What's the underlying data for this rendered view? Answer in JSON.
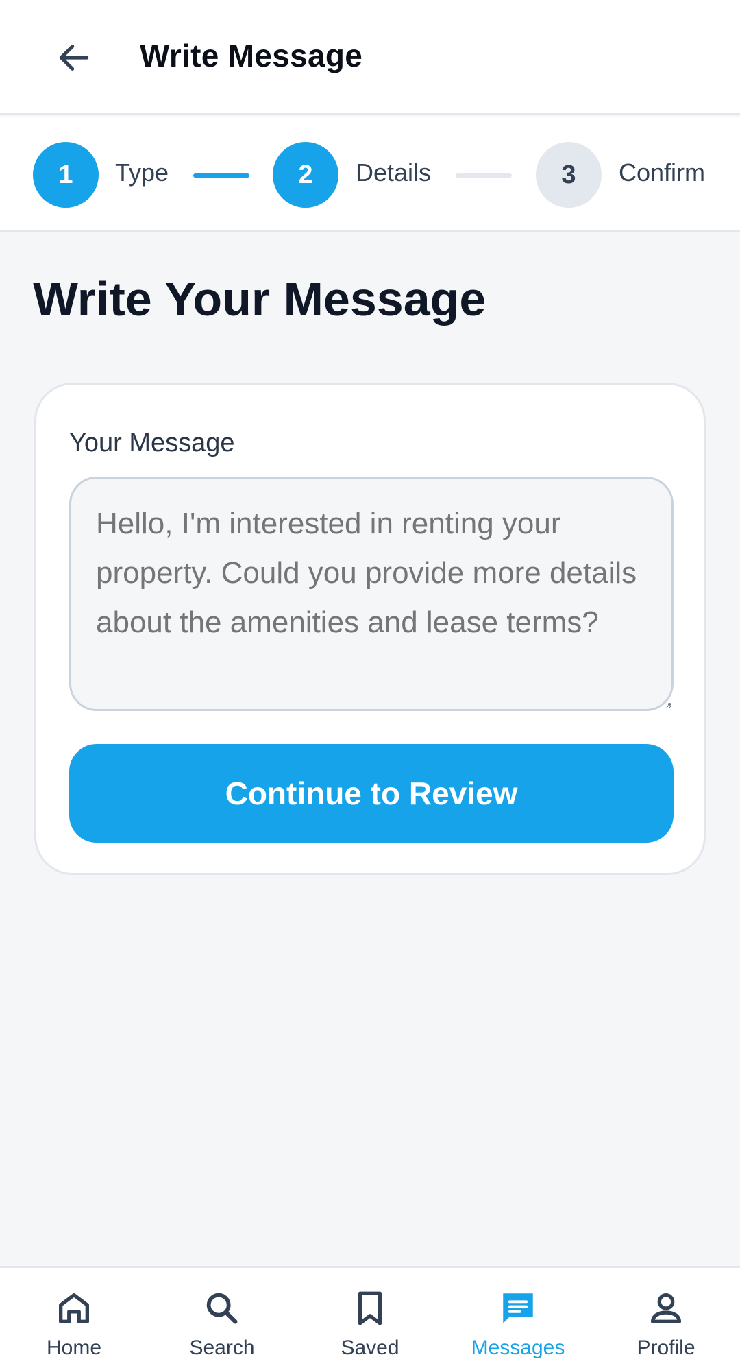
{
  "appbar": {
    "title": "Write Message",
    "back_icon": "arrow-left-icon"
  },
  "stepper": {
    "steps": [
      {
        "number": "1",
        "label": "Type",
        "state": "complete"
      },
      {
        "number": "2",
        "label": "Details",
        "state": "current"
      },
      {
        "number": "3",
        "label": "Confirm",
        "state": "upcoming"
      }
    ]
  },
  "page": {
    "heading": "Write Your Message"
  },
  "form": {
    "message_label": "Your Message",
    "message_placeholder": "Hello, I'm interested in renting your property. Could you provide more details about the amenities and lease terms?",
    "message_value": "",
    "submit_label": "Continue to Review"
  },
  "bottom_nav": {
    "items": [
      {
        "label": "Home",
        "icon": "home-icon",
        "active": false
      },
      {
        "label": "Search",
        "icon": "search-icon",
        "active": false
      },
      {
        "label": "Saved",
        "icon": "bookmark-icon",
        "active": false
      },
      {
        "label": "Messages",
        "icon": "messages-icon",
        "active": true
      },
      {
        "label": "Profile",
        "icon": "profile-icon",
        "active": false
      }
    ]
  },
  "colors": {
    "accent": "#16a3e9",
    "background": "#f4f6f8",
    "surface": "#ffffff",
    "inactive_step": "#e3e8ef",
    "text_primary": "#101828",
    "text_secondary": "#334155"
  }
}
